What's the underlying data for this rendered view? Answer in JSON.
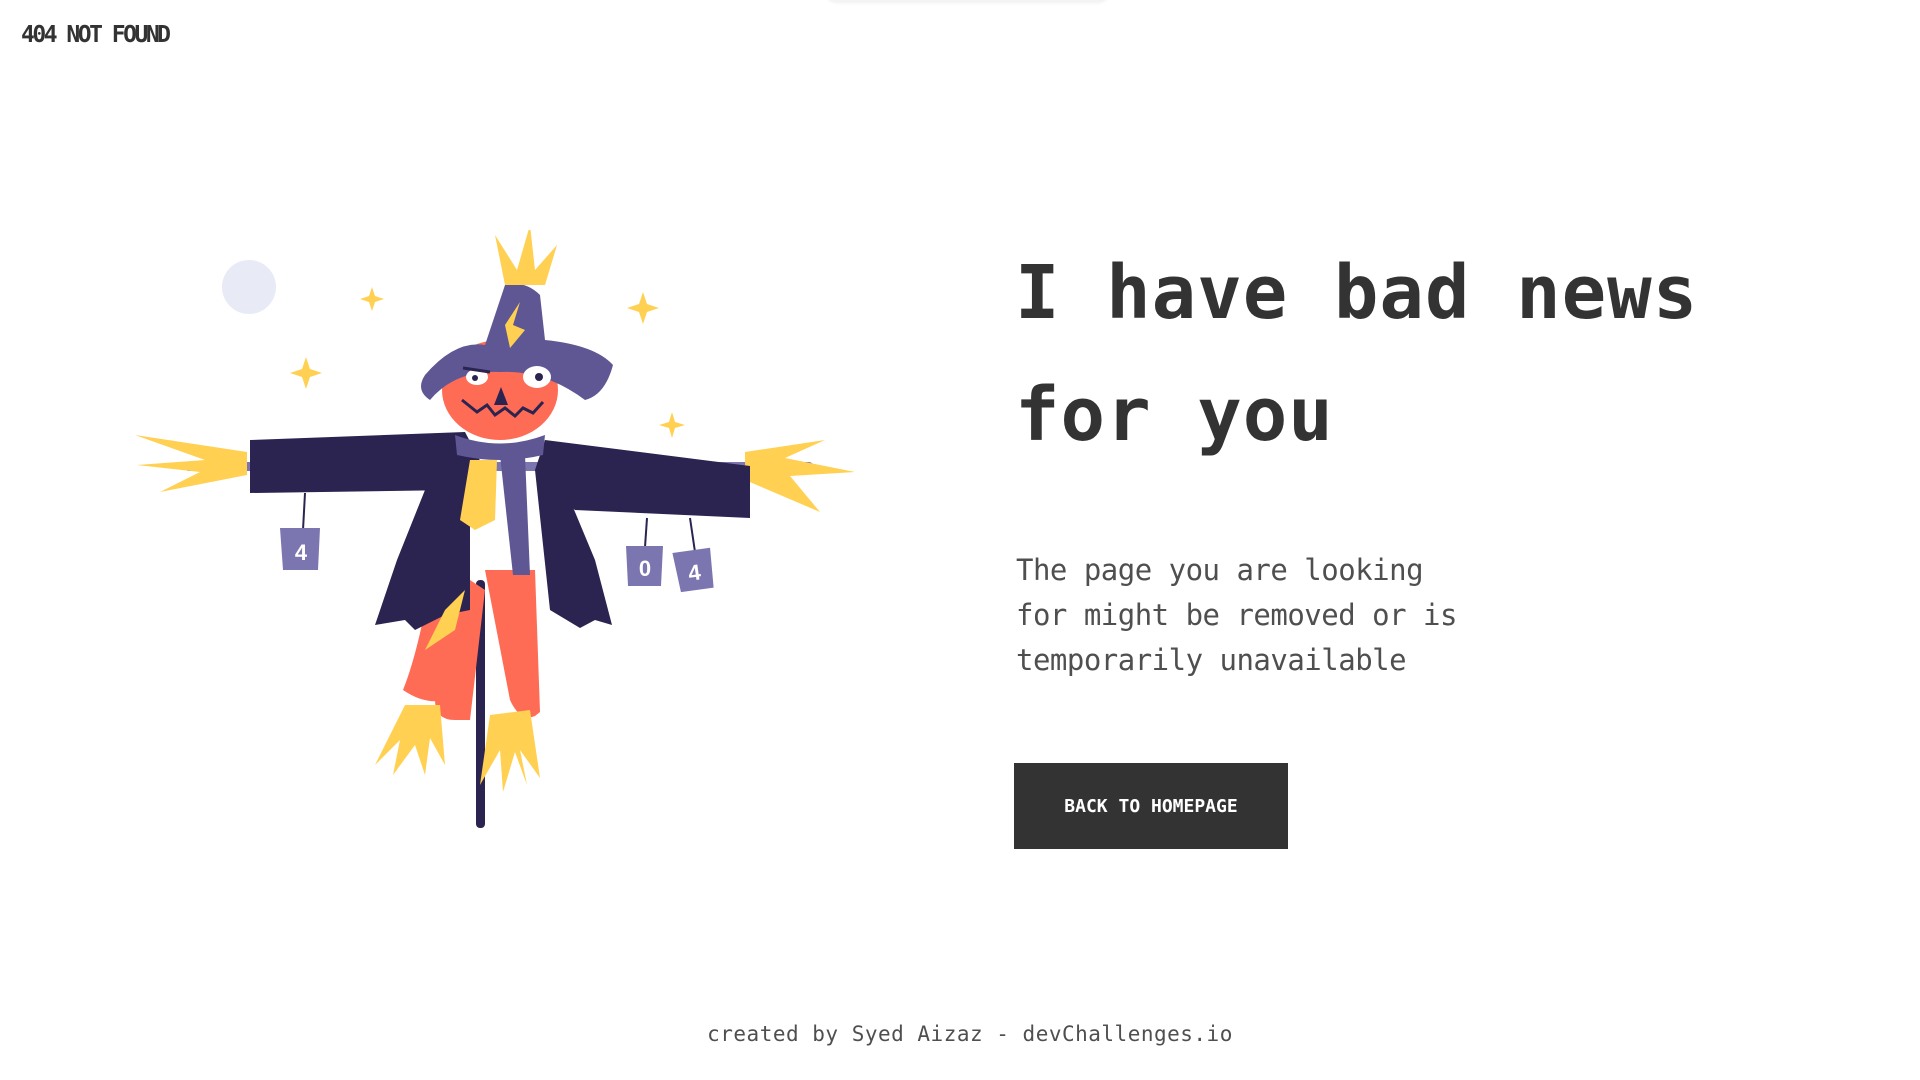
{
  "header": {
    "logo_text": "404 NOT FOUND"
  },
  "illustration": {
    "icon": "scarecrow-illustration",
    "cans": [
      "4",
      "0",
      "4"
    ],
    "colors": {
      "coat": "#2b2350",
      "hat": "#5e5794",
      "face": "#ff6c55",
      "straw": "#ffd051",
      "moon": "#e8ebf6"
    }
  },
  "main": {
    "headline_line1": "I have bad news",
    "headline_line2": "for you",
    "message_line1": "The page you are looking",
    "message_line2": "for might be removed or is",
    "message_line3": "temporarily unavailable",
    "button_label": "BACK TO HOMEPAGE"
  },
  "footer": {
    "credit": "created by Syed Aizaz - devChallenges.io"
  },
  "theme": {
    "text": "#333333",
    "button_bg": "#333333",
    "button_text": "#ffffff",
    "background": "#ffffff"
  }
}
